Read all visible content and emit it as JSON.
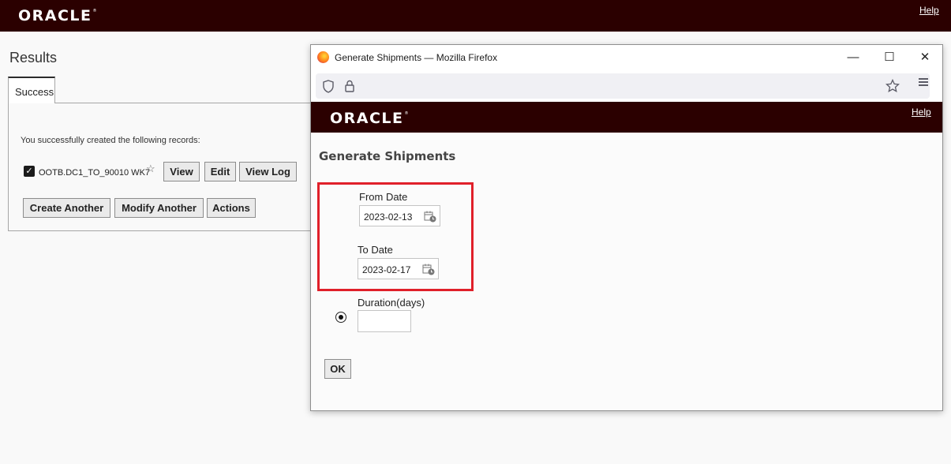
{
  "app": {
    "logo": "ORACLE",
    "help": "Help"
  },
  "results": {
    "title": "Results",
    "tab": "Success",
    "message": "You successfully created the following records:",
    "record": {
      "name": "OOTB.DC1_TO_90010 WK7",
      "checked": true
    },
    "record_buttons": {
      "view": "View",
      "edit": "Edit",
      "view_log": "View Log"
    },
    "action_buttons": {
      "create_another": "Create Another",
      "modify_another": "Modify Another",
      "actions": "Actions"
    }
  },
  "firefox": {
    "title": "Generate Shipments — Mozilla Firefox",
    "url": "",
    "icons": [
      "firefox-logo-icon",
      "shield-icon",
      "lock-icon",
      "star-icon",
      "menu-icon",
      "minimize-icon",
      "maximize-icon",
      "close-icon"
    ]
  },
  "popup": {
    "logo": "ORACLE",
    "help": "Help",
    "title": "Generate Shipments",
    "from_date": {
      "label": "From Date",
      "value": "2023-02-13"
    },
    "to_date": {
      "label": "To Date",
      "value": "2023-02-17",
      "selected": true
    },
    "duration": {
      "label": "Duration(days)",
      "value": "",
      "selected": false
    },
    "ok": "OK"
  },
  "colors": {
    "header": "#2b0000",
    "highlight": "#e0202a"
  }
}
